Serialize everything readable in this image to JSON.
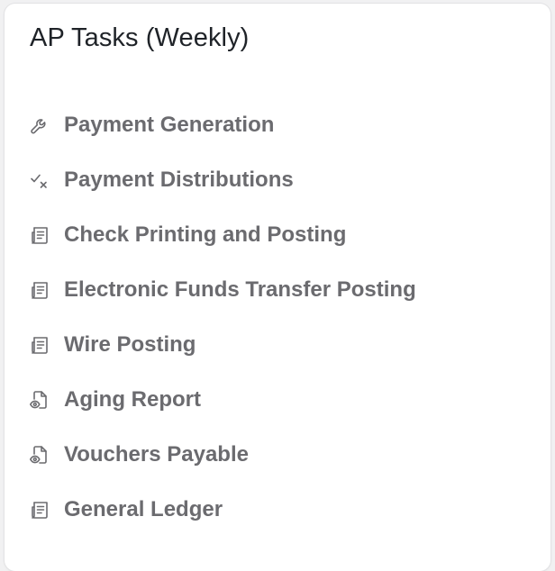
{
  "card": {
    "title": "AP Tasks (Weekly)"
  },
  "tasks": [
    {
      "label": "Payment Generation",
      "icon": "wrench-icon"
    },
    {
      "label": "Payment Distributions",
      "icon": "check-x-icon"
    },
    {
      "label": "Check Printing and Posting",
      "icon": "ledger-icon"
    },
    {
      "label": "Electronic Funds Transfer Posting",
      "icon": "ledger-icon"
    },
    {
      "label": "Wire Posting",
      "icon": "ledger-icon"
    },
    {
      "label": "Aging Report",
      "icon": "file-eye-icon"
    },
    {
      "label": "Vouchers Payable",
      "icon": "file-eye-icon"
    },
    {
      "label": "General Ledger",
      "icon": "ledger-icon"
    }
  ],
  "colors": {
    "title": "#1f2328",
    "label": "#6b6b6f",
    "icon": "#6b6b6f",
    "card_background": "#ffffff",
    "page_background": "#f1f1f2"
  }
}
